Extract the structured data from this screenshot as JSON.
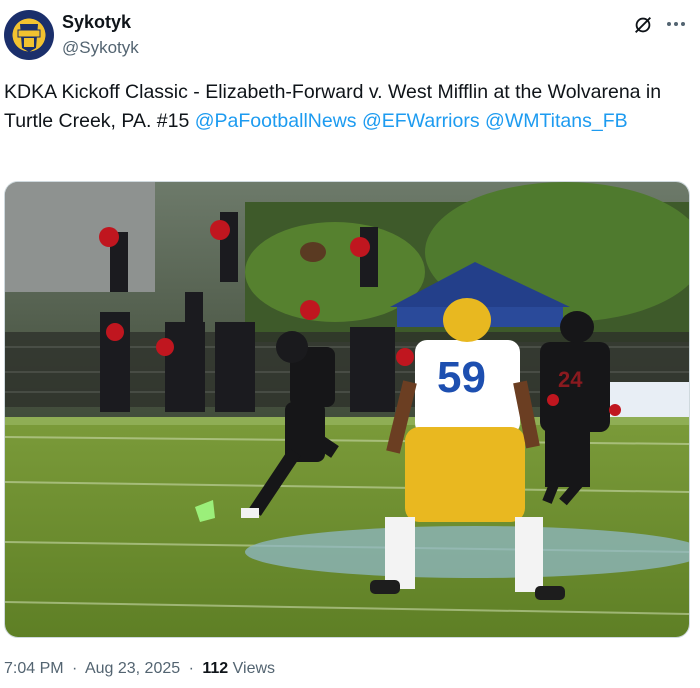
{
  "author": {
    "display_name": "Sykotyk",
    "handle": "@Sykotyk",
    "avatar_icon": "titans-logo-avatar"
  },
  "tweet": {
    "text_plain": "KDKA Kickoff Classic - Elizabeth-Forward v. West Mifflin at the Wolvarena in Turtle Creek, PA. #15",
    "mentions": [
      "@PaFootballNews",
      "@EFWarriors",
      "@WMTitans_FB"
    ],
    "jersey_number": "59"
  },
  "meta": {
    "time": "7:04 PM",
    "date": "Aug 23, 2025",
    "views_count": "112",
    "views_label": "Views",
    "separator": "·"
  },
  "icons": {
    "grok": "grok-icon",
    "more": "more-options-icon"
  },
  "colors": {
    "mention": "#1d9bf0",
    "secondary_text": "#536471",
    "primary_text": "#0f1419"
  }
}
